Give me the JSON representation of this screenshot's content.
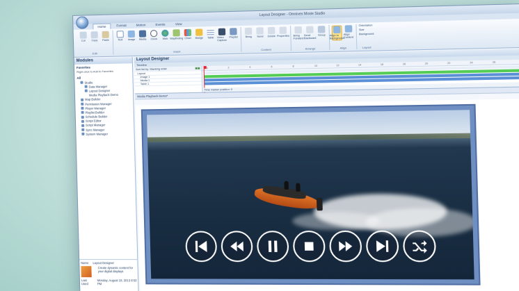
{
  "window": {
    "title": "Layout Designer - Omnivex Moxie Studio"
  },
  "ribbon": {
    "tabs": [
      "Home",
      "Format",
      "Motion",
      "Events",
      "View"
    ],
    "groups": [
      {
        "label": "Edit",
        "items": [
          "Cut",
          "Copy",
          "Paste"
        ]
      },
      {
        "label": "Insert",
        "items": [
          "Text",
          "Image",
          "Media",
          "Clock",
          "Web",
          "Wayfinding",
          "Chart",
          "Badge",
          "Table",
          "Video Capture",
          "Playlist"
        ]
      },
      {
        "label": "Content",
        "items": [
          "Bring",
          "Send",
          "Delete",
          "Properties"
        ]
      },
      {
        "label": "Arrange",
        "items": [
          "Bring Forward",
          "Send Backward",
          "Group"
        ]
      },
      {
        "label": "Align",
        "items": [
          "Align to Background",
          "Align Content"
        ]
      },
      {
        "label": "Layout",
        "items": [
          "Orientation",
          "Size",
          "Background"
        ]
      }
    ]
  },
  "modules": {
    "title": "Modules",
    "favorites_label": "Favorites",
    "favorites_hint": "Right-click to Add to Favorites",
    "all_label": "All",
    "items": [
      {
        "label": "Studio",
        "level": 0
      },
      {
        "label": "Data Manager",
        "level": 1
      },
      {
        "label": "Layout Designer",
        "level": 1
      },
      {
        "label": "Media Playback Demo",
        "level": 2
      },
      {
        "label": "Map Builder",
        "level": 0
      },
      {
        "label": "Permission Manager",
        "level": 0
      },
      {
        "label": "Player Manager",
        "level": 0
      },
      {
        "label": "Playlist Builder",
        "level": 0
      },
      {
        "label": "Schedule Builder",
        "level": 0
      },
      {
        "label": "Script Editor",
        "level": 0
      },
      {
        "label": "Script Manager",
        "level": 0
      },
      {
        "label": "Sync Manager",
        "level": 0
      },
      {
        "label": "System Manager",
        "level": 0
      }
    ],
    "details": {
      "name_label": "Name",
      "name_value": "Layout Designer",
      "description": "Create dynamic content for your digital displays",
      "last_used_label": "Last Used",
      "last_used_value": "Monday, August 19, 2013 8:53 PM"
    }
  },
  "designer": {
    "title": "Layout Designer",
    "timeline_label": "Timeline",
    "sort_label": "Sort list by: Stacking order",
    "tree": [
      "Layout",
      "Image 1",
      "Media 1",
      "Table 1"
    ],
    "ruler_ticks": [
      "0",
      "2",
      "4",
      "6",
      "8",
      "10",
      "12",
      "14",
      "16",
      "18",
      "20",
      "22",
      "24",
      "26"
    ],
    "marker_label": "Time marker position: 0",
    "document_tab": "Media Playback Demo*"
  },
  "player": {
    "controls": [
      {
        "name": "skip-to-start-button",
        "icon": "skip-start-icon"
      },
      {
        "name": "rewind-button",
        "icon": "rewind-icon"
      },
      {
        "name": "pause-button",
        "icon": "pause-icon"
      },
      {
        "name": "stop-button",
        "icon": "stop-icon"
      },
      {
        "name": "fast-forward-button",
        "icon": "fast-forward-icon"
      },
      {
        "name": "skip-to-end-button",
        "icon": "skip-end-icon"
      },
      {
        "name": "shuffle-button",
        "icon": "shuffle-icon"
      }
    ]
  },
  "colors": {
    "accent": "#2f5f99",
    "timeline_green": "#55cc55",
    "timeline_blue": "#5b8fd6",
    "frame": "#6f8fc2"
  }
}
